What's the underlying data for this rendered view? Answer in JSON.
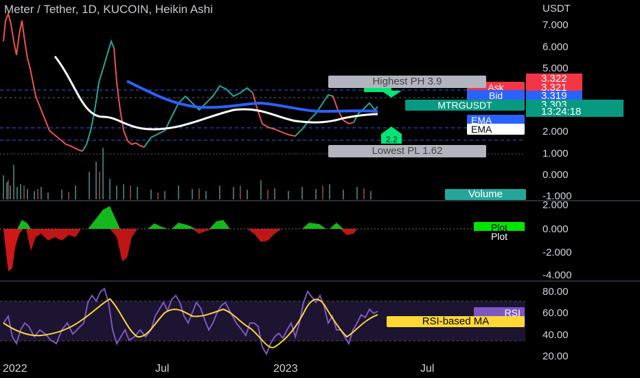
{
  "header": {
    "title": "Meter / Tether, 1D, KUCOIN, Heikin Ashi",
    "currency": "USDT"
  },
  "price_axis": [
    "7.000",
    "6.000",
    "5.000",
    "2.000",
    "1.000",
    "0.000",
    "-1.000"
  ],
  "osc_axis": [
    "2.000",
    "0.000",
    "-2.000",
    "-4.000"
  ],
  "rsi_axis": [
    "80.00",
    "60.00",
    "40.00",
    "20.00"
  ],
  "x_axis": [
    "2022",
    "Jul",
    "2023",
    "Jul"
  ],
  "price_tags": {
    "ask_label": "Ask",
    "ask_value": "3.322",
    "bid_label": "Bid",
    "bid_value": "3.321",
    "last_value": "3.319",
    "symbol": "MTRGUSDT",
    "symbol_value": "3.303",
    "countdown": "13:24:18"
  },
  "labels": {
    "highest": "Highest PH 3.9",
    "lowest": "Lowest PL 1.62",
    "mid_up": "2.2",
    "ema1": "EMA",
    "ema2": "EMA",
    "volume": "Volume",
    "plot1": "Plot",
    "plot2": "Plot",
    "rsi": "RSI",
    "rsi_ma": "RSI-based MA"
  },
  "colors": {
    "bg": "#000000",
    "up": "#26a69a",
    "down": "#ef5350",
    "ema_blue": "#2962ff",
    "ema_white": "#ffffff",
    "rsi": "#7e57c2",
    "rsi_ma": "#fdd835",
    "tag_red": "#f23645",
    "tag_blue": "#2962ff",
    "tag_teal": "#089981"
  }
}
